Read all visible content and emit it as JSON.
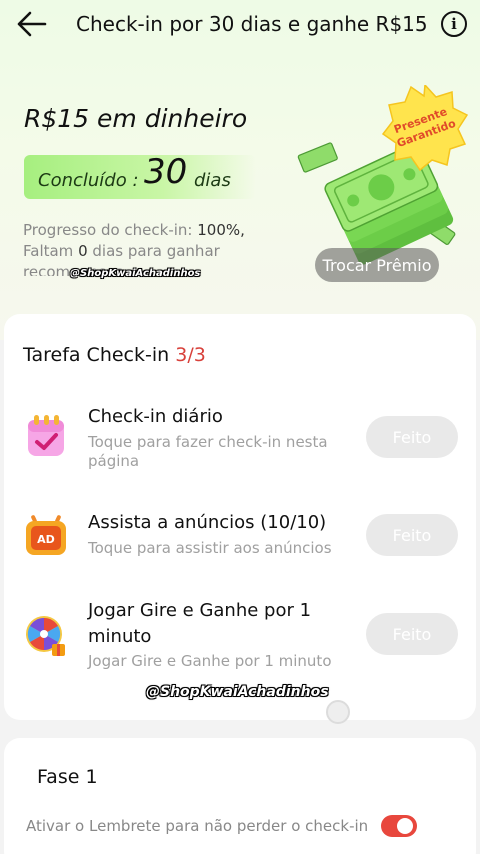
{
  "header": {
    "title": "Check-in por 30 dias e ganhe R$15",
    "back_icon": "arrow-left-icon",
    "info_icon": "info-icon"
  },
  "hero": {
    "reward_heading": "R$15 em dinheiro",
    "completed_label": "Concluído :",
    "completed_days": "30",
    "completed_unit": "dias",
    "progress_label": "Progresso do check-in:",
    "progress_value": "100%,",
    "remaining_prefix": "Faltam",
    "remaining_days": "0",
    "remaining_suffix": "dias para ganhar recompensas",
    "badge_text_line1": "Presente",
    "badge_text_line2": "Garantido",
    "trade_button": "Trocar Prêmio",
    "colors": {
      "accent_green": "#a6ef7f",
      "badge_yellow": "#ffe44d",
      "badge_text": "#e04a2a"
    }
  },
  "watermark": "@ShopKwaiAchadinhos",
  "tasks": {
    "heading": "Tarefa Check-in",
    "count": "3/3",
    "count_color": "#d8413b",
    "items": [
      {
        "icon": "calendar-check-icon",
        "title": "Check-in diário",
        "desc": "Toque para fazer check-in nesta página",
        "button": "Feito"
      },
      {
        "icon": "tv-ad-icon",
        "title": "Assista a anúncios  (10/10)",
        "desc": "Toque para assistir aos anúncios",
        "button": "Feito"
      },
      {
        "icon": "spin-wheel-icon",
        "title": "Jogar Gire e Ganhe por 1 minuto",
        "desc": "Jogar Gire e Ganhe por 1 minuto",
        "button": "Feito"
      }
    ]
  },
  "phase": {
    "title": "Fase 1",
    "reminder": "Ativar o Lembrete para não perder o check-in",
    "reminder_on": true,
    "toggle_color": "#e8473d"
  }
}
